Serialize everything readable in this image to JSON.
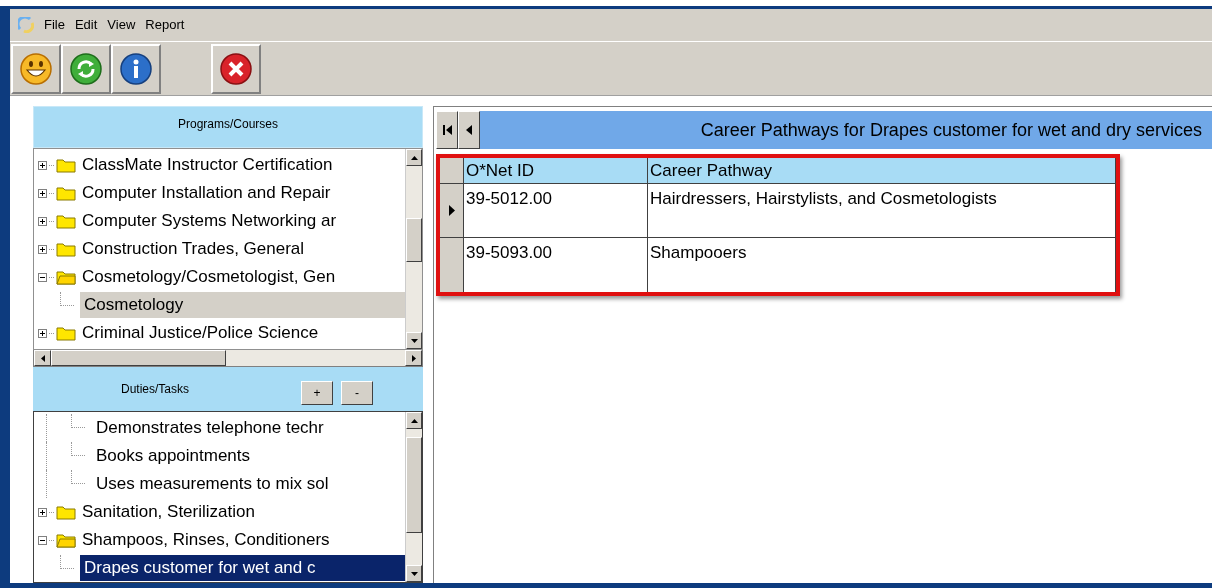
{
  "menu": [
    "File",
    "Edit",
    "View",
    "Report"
  ],
  "toolbar": [
    {
      "kind": "smiley"
    },
    {
      "kind": "refresh"
    },
    {
      "kind": "info"
    },
    {
      "kind": "spacer"
    },
    {
      "kind": "close"
    }
  ],
  "programs": {
    "title": "Programs/Courses",
    "focused": false,
    "items": [
      {
        "label": "ClassMate Instructor Certification",
        "kind": "folder",
        "expanded": false,
        "selected": false
      },
      {
        "label": "Computer Installation and Repair",
        "kind": "folder",
        "expanded": false,
        "selected": false
      },
      {
        "label": "Computer Systems Networking ar",
        "kind": "folder",
        "expanded": false,
        "selected": false
      },
      {
        "label": "Construction Trades, General",
        "kind": "folder",
        "expanded": false,
        "selected": false
      },
      {
        "label": "Cosmetology/Cosmetologist, Gen",
        "kind": "folder",
        "expanded": true,
        "selected": false,
        "children": [
          {
            "label": "Cosmetology",
            "selected": true
          }
        ]
      },
      {
        "label": "Criminal Justice/Police Science",
        "kind": "folder",
        "expanded": false,
        "selected": false
      }
    ]
  },
  "duties": {
    "title": "Duties/Tasks",
    "buttons": [
      "+",
      "-"
    ],
    "focused": true,
    "items": [
      {
        "label": "Demonstrates telephone techr",
        "kind": "task",
        "selected": false
      },
      {
        "label": "Books appointments",
        "kind": "task",
        "selected": false
      },
      {
        "label": "Uses measurements to mix sol",
        "kind": "task",
        "selected": false
      },
      {
        "label": "Sanitation, Sterilization",
        "kind": "folder",
        "expanded": false,
        "selected": false
      },
      {
        "label": "Shampoos, Rinses, Conditioners",
        "kind": "folder",
        "expanded": true,
        "selected": false,
        "children": [
          {
            "label": "Drapes customer for wet and c",
            "selected": true
          }
        ]
      }
    ]
  },
  "grid": {
    "title": "Career Pathways for Drapes customer for wet and dry services",
    "columns": [
      "O*Net ID",
      "Career Pathway"
    ],
    "rows": [
      {
        "cells": [
          "39-5012.00",
          "Hairdressers, Hairstylists, and Cosmetologists"
        ],
        "selected": true
      },
      {
        "cells": [
          "39-5093.00",
          "Shampooers"
        ],
        "selected": false
      }
    ]
  }
}
